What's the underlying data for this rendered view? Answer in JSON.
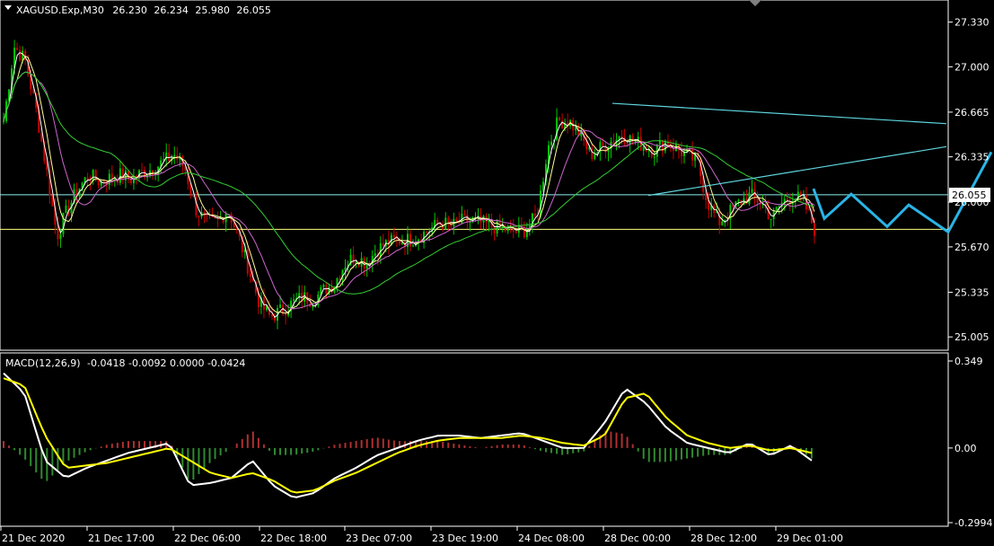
{
  "symbol_info": {
    "symbol": "XAGUSD.Exp,M30",
    "open": "26.230",
    "high": "26.234",
    "low": "25.980",
    "close": "26.055"
  },
  "macd_info": {
    "name": "MACD(12,26,9)",
    "values": "-0.0418 -0.0092 0.0000 -0.0424"
  },
  "price_axis": [
    "27.330",
    "27.000",
    "26.665",
    "26.335",
    "26.000",
    "25.670",
    "25.335",
    "25.005"
  ],
  "price_box": "26.055",
  "macd_axis": [
    "0.349",
    "0.00",
    "-0.2994"
  ],
  "time_axis": [
    "21 Dec 2020",
    "21 Dec 17:00",
    "22 Dec 06:00",
    "22 Dec 18:00",
    "23 Dec 07:00",
    "23 Dec 19:00",
    "24 Dec 08:00",
    "28 Dec 00:00",
    "28 Dec 12:00",
    "29 Dec 01:00"
  ],
  "colors": {
    "background": "#000000",
    "bull": "#00c800",
    "bear": "#c80000",
    "ma_fast": "#ffffff",
    "ma_yellow": "#ffff99",
    "ma_violet": "#cc66cc",
    "ma_slow": "#33cc33",
    "trendline": "#5fd7e0",
    "hline": "#8cf0f0",
    "hline_yellow": "#ffff80",
    "projection": "#2ab4e6",
    "macd_main": "#ffffff",
    "macd_signal": "#ffff00",
    "hist_pos": "#b03030",
    "hist_neg": "#2f8a2f",
    "axis": "#ffffff"
  },
  "chart_data": {
    "type": "candlestick",
    "price_range": [
      24.92,
      27.48
    ],
    "hlines": [
      26.055,
      25.8
    ],
    "close_series": [
      26.6,
      27.15,
      27.05,
      26.7,
      26.25,
      25.75,
      25.95,
      26.1,
      26.2,
      26.15,
      26.18,
      26.2,
      26.17,
      26.22,
      26.25,
      26.3,
      26.35,
      26.25,
      25.95,
      25.85,
      25.85,
      25.95,
      25.75,
      25.5,
      25.25,
      25.15,
      25.2,
      25.25,
      25.3,
      25.28,
      25.35,
      25.4,
      25.55,
      25.6,
      25.55,
      25.65,
      25.7,
      25.72,
      25.72,
      25.75,
      25.8,
      25.85,
      25.82,
      25.86,
      25.86,
      25.84,
      25.82,
      25.8,
      25.78,
      25.8,
      25.9,
      26.4,
      26.6,
      26.6,
      26.5,
      26.35,
      26.4,
      26.45,
      26.5,
      26.45,
      26.42,
      26.38,
      26.45,
      26.4,
      26.35,
      26.3,
      26.0,
      25.85,
      25.92,
      26.0,
      26.05,
      26.0,
      25.88,
      26.0,
      26.05,
      26.0,
      25.8
    ],
    "trendlines": [
      {
        "from": [
          "28 Dec 00:00",
          26.73
        ],
        "to": [
          "right edge",
          26.58
        ]
      },
      {
        "from": [
          "28 Dec 02:00",
          26.05
        ],
        "to": [
          "right edge",
          26.41
        ]
      }
    ],
    "macd_main": [
      0.3,
      0.22,
      -0.05,
      -0.12,
      -0.08,
      -0.05,
      -0.02,
      0.0,
      0.02,
      -0.15,
      -0.14,
      -0.12,
      -0.05,
      -0.15,
      -0.2,
      -0.18,
      -0.12,
      -0.08,
      -0.03,
      0.0,
      0.03,
      0.05,
      0.05,
      0.04,
      0.05,
      0.06,
      0.03,
      0.0,
      0.0,
      0.1,
      0.24,
      0.18,
      0.08,
      0.02,
      0.0,
      -0.02,
      0.02,
      -0.03,
      0.01,
      -0.05
    ],
    "macd_signal": [
      0.28,
      0.25,
      0.05,
      -0.08,
      -0.07,
      -0.06,
      -0.04,
      -0.02,
      0.0,
      -0.05,
      -0.1,
      -0.12,
      -0.1,
      -0.13,
      -0.18,
      -0.17,
      -0.13,
      -0.1,
      -0.06,
      -0.02,
      0.01,
      0.03,
      0.04,
      0.04,
      0.04,
      0.05,
      0.04,
      0.02,
      0.01,
      0.05,
      0.2,
      0.22,
      0.12,
      0.05,
      0.02,
      0.0,
      0.01,
      -0.01,
      0.0,
      -0.02
    ],
    "macd_range": [
      -0.2994,
      0.349
    ]
  }
}
